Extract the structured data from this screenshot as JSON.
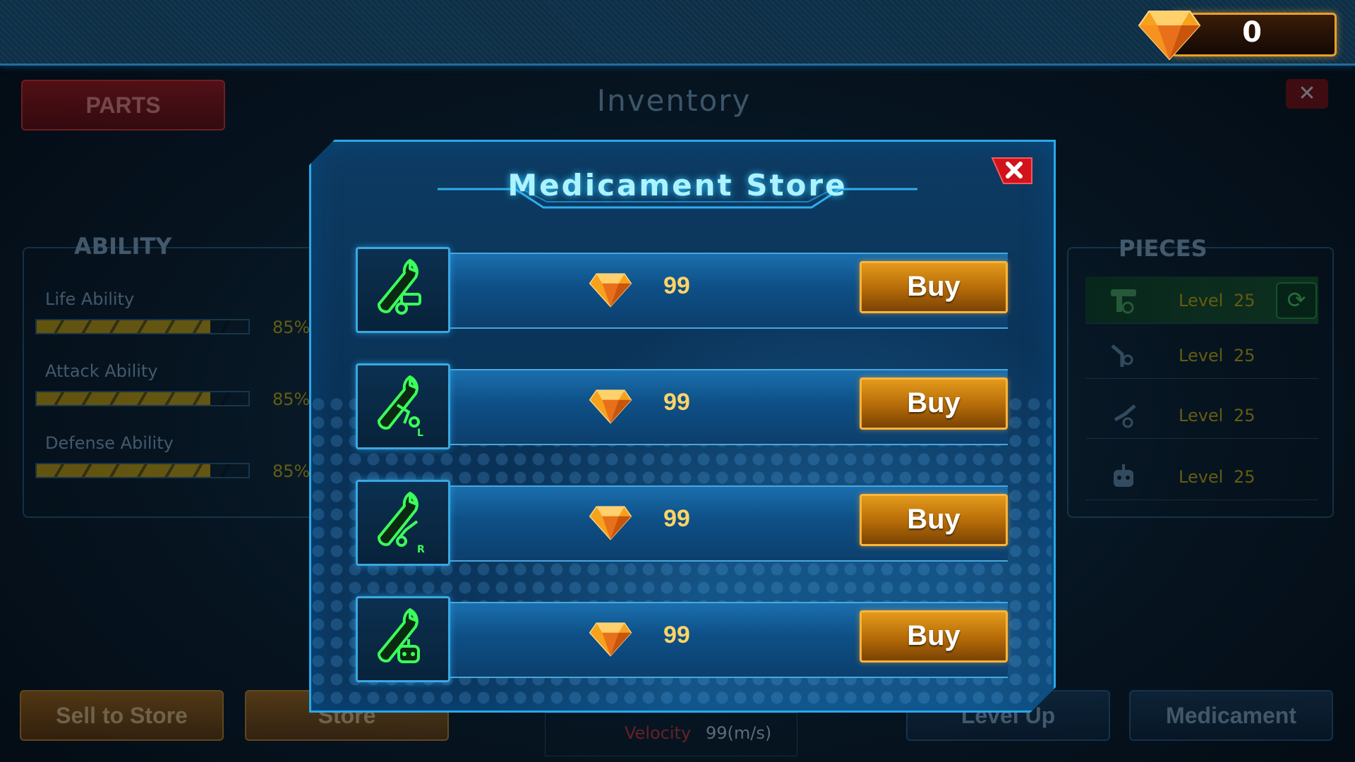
{
  "header": {
    "gem_count": "0"
  },
  "background": {
    "parts_label": "PARTS",
    "inventory_title": "Inventory",
    "ability": {
      "title": "ABILITY",
      "items": [
        {
          "label": "Life Ability",
          "percent": "85%"
        },
        {
          "label": "Attack Ability",
          "percent": "85%"
        },
        {
          "label": "Defense Ability",
          "percent": "85%"
        }
      ]
    },
    "pieces": {
      "title": "PIECES",
      "rows": [
        {
          "level_label": "Level",
          "level": "25",
          "icon": "arm-part-icon"
        },
        {
          "level_label": "Level",
          "level": "25",
          "icon": "left-arm-icon"
        },
        {
          "level_label": "Level",
          "level": "25",
          "icon": "right-arm-icon"
        },
        {
          "level_label": "Level",
          "level": "25",
          "icon": "robot-head-icon"
        }
      ]
    },
    "buttons": {
      "sell_to_store": "Sell to Store",
      "store": "Store",
      "level_up": "Level Up",
      "medicament": "Medicament"
    },
    "velocity": {
      "label": "Velocity",
      "value": "99(m/s)"
    }
  },
  "modal": {
    "title": "Medicament Store",
    "items": [
      {
        "icon": "repair-arm-icon",
        "price": "99",
        "buy_label": "Buy"
      },
      {
        "icon": "repair-left-arm-icon",
        "price": "99",
        "buy_label": "Buy"
      },
      {
        "icon": "repair-right-arm-icon",
        "price": "99",
        "buy_label": "Buy"
      },
      {
        "icon": "repair-robot-icon",
        "price": "99",
        "buy_label": "Buy"
      }
    ]
  },
  "colors": {
    "accent": "#2aa8e8",
    "buy": "#e39a1b",
    "icon_green": "#3bff5a",
    "price": "#ffd466"
  }
}
